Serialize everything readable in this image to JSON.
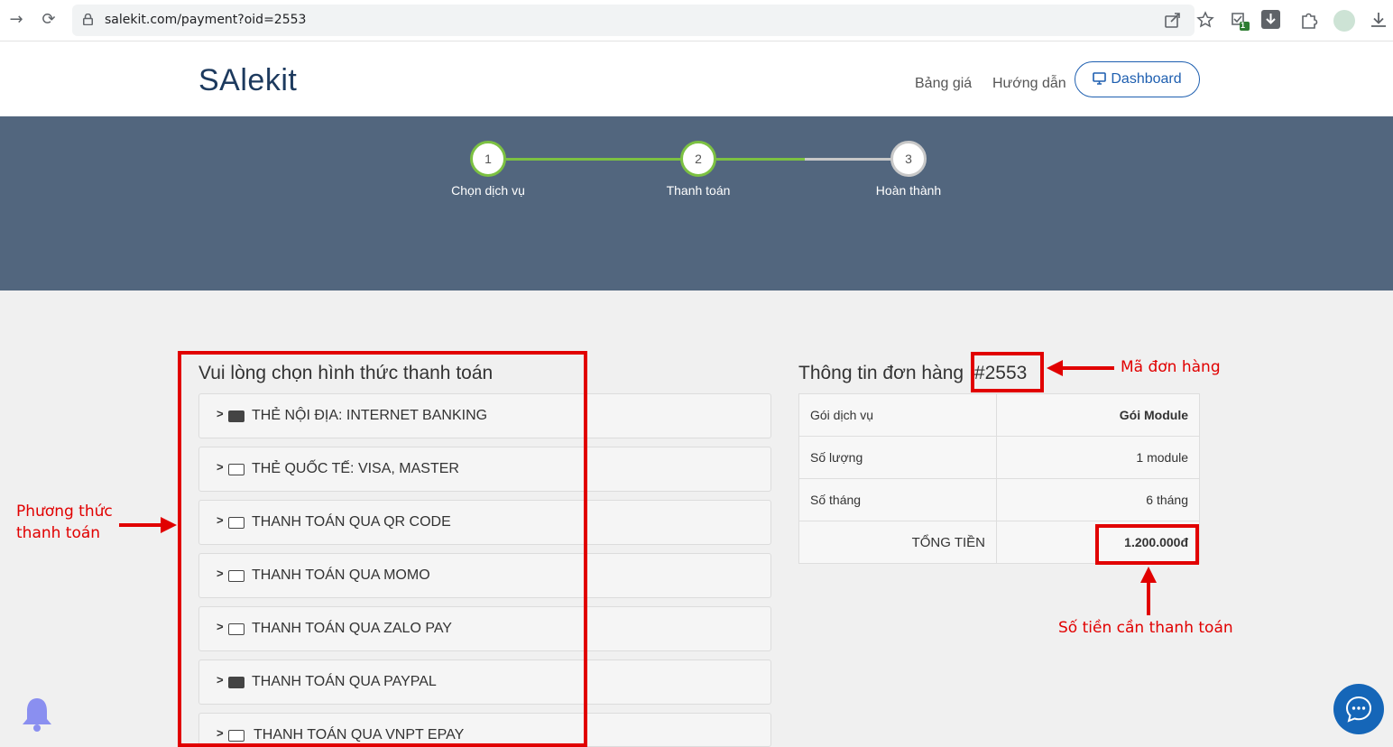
{
  "browser": {
    "url": "salekit.com/payment?oid=2553",
    "icons": [
      "back-arrow-icon",
      "reload-icon",
      "lock-icon",
      "share-icon",
      "star-icon",
      "extension-badge-icon",
      "download-ext-icon",
      "puzzle-icon",
      "profile-icon",
      "download-icon"
    ],
    "badge_count": "1"
  },
  "header": {
    "logo": "SAlekit",
    "nav": [
      "Bảng giá",
      "Hướng dẫn"
    ],
    "dashboard_label": "Dashboard"
  },
  "stepper": {
    "steps": [
      {
        "number": "1",
        "label": "Chọn dịch vụ",
        "state": "done"
      },
      {
        "number": "2",
        "label": "Thanh toán",
        "state": "active"
      },
      {
        "number": "3",
        "label": "Hoàn thành",
        "state": "pending"
      }
    ],
    "colors": {
      "done": "#7cc142",
      "pending": "#c8c8c8",
      "band": "#52667e"
    }
  },
  "payment": {
    "title": "Vui lòng chọn hình thức thanh toán",
    "methods": [
      "THẺ NỘI ĐỊA: INTERNET BANKING",
      "THẺ QUỐC TẾ: VISA, MASTER",
      "THANH TOÁN QUA QR CODE",
      "THANH TOÁN QUA MOMO",
      "THANH TOÁN QUA ZALO PAY",
      "THANH TOÁN QUA PAYPAL",
      "THANH TOÁN QUA VNPT EPAY"
    ]
  },
  "order": {
    "title": "Thông tin đơn hàng",
    "order_id": "#2553",
    "rows": [
      {
        "label": "Gói dịch vụ",
        "value": "Gói Module"
      },
      {
        "label": "Số lượng",
        "value": "1 module"
      },
      {
        "label": "Số tháng",
        "value": "6 tháng"
      },
      {
        "label": "TỔNG TIỀN",
        "value": "1.200.000đ"
      }
    ]
  },
  "annotations": {
    "order_code": "Mã đơn hàng",
    "payment_method_line1": "Phương thức",
    "payment_method_line2": "thanh toán",
    "amount": "Số tiền cần thanh toán",
    "color": "#e10000"
  }
}
